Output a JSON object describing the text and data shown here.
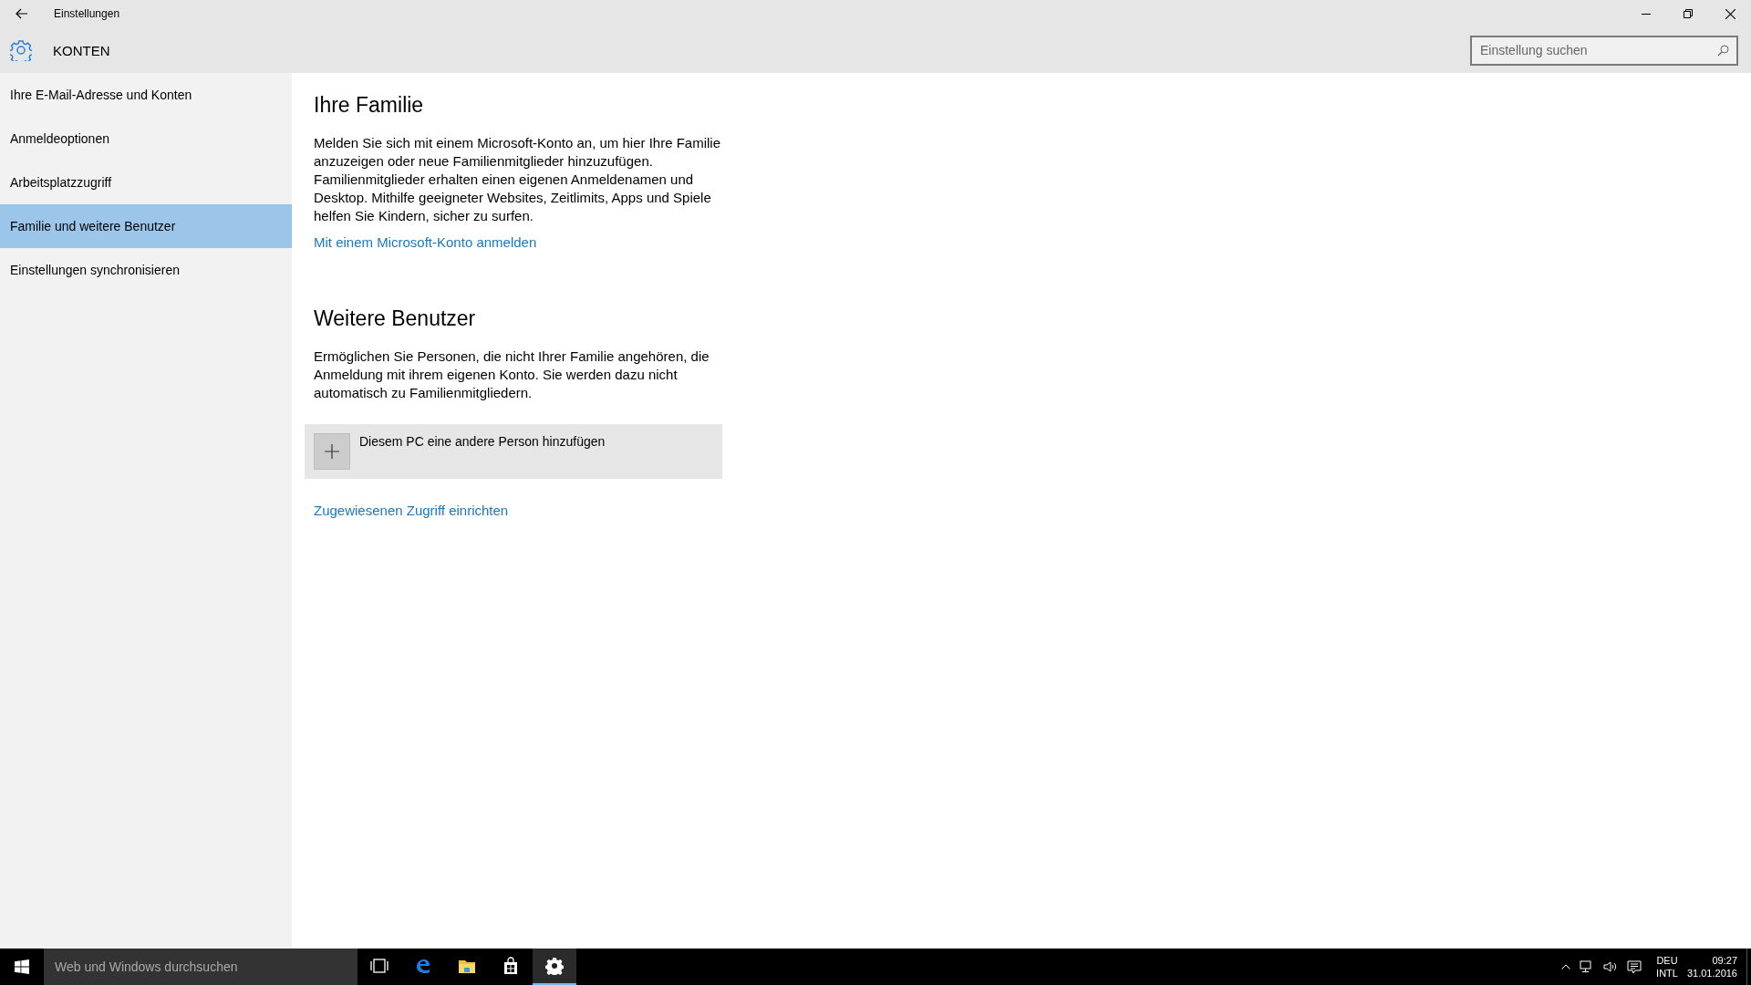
{
  "window": {
    "title": "Einstellungen"
  },
  "header": {
    "title": "KONTEN",
    "search": {
      "placeholder": "Einstellung suchen"
    }
  },
  "sidebar": {
    "items": [
      {
        "label": "Ihre E-Mail-Adresse und Konten",
        "selected": false
      },
      {
        "label": "Anmeldeoptionen",
        "selected": false
      },
      {
        "label": "Arbeitsplatzzugriff",
        "selected": false
      },
      {
        "label": "Familie und weitere Benutzer",
        "selected": true
      },
      {
        "label": "Einstellungen synchronisieren",
        "selected": false
      }
    ]
  },
  "content": {
    "sections": [
      {
        "heading": "Ihre Familie",
        "text": "Melden Sie sich mit einem Microsoft-Konto an, um hier Ihre Familie anzuzeigen oder neue Familienmitglieder hinzuzufügen. Familienmitglieder erhalten einen eigenen Anmeldenamen und Desktop. Mithilfe geeigneter Websites, Zeitlimits, Apps und Spiele helfen Sie Kindern, sicher zu surfen.",
        "link": "Mit einem Microsoft-Konto anmelden"
      },
      {
        "heading": "Weitere Benutzer",
        "text": "Ermöglichen Sie Personen, die nicht Ihrer Familie angehören, die Anmeldung mit ihrem eigenen Konto. Sie werden dazu nicht automatisch zu Familienmitgliedern.",
        "add_button": "Diesem PC eine andere Person hinzufügen",
        "link": "Zugewiesenen Zugriff einrichten"
      }
    ]
  },
  "taskbar": {
    "search": {
      "placeholder": "Web und Windows durchsuchen"
    },
    "apps": [
      {
        "kind": "taskview",
        "selected": false
      },
      {
        "kind": "edge",
        "selected": false
      },
      {
        "kind": "explorer",
        "selected": false
      },
      {
        "kind": "store",
        "selected": false
      },
      {
        "kind": "settings",
        "selected": true
      }
    ],
    "language": [
      "DEU",
      "INTL"
    ],
    "time": "09:27",
    "date": "31.01.2016"
  }
}
